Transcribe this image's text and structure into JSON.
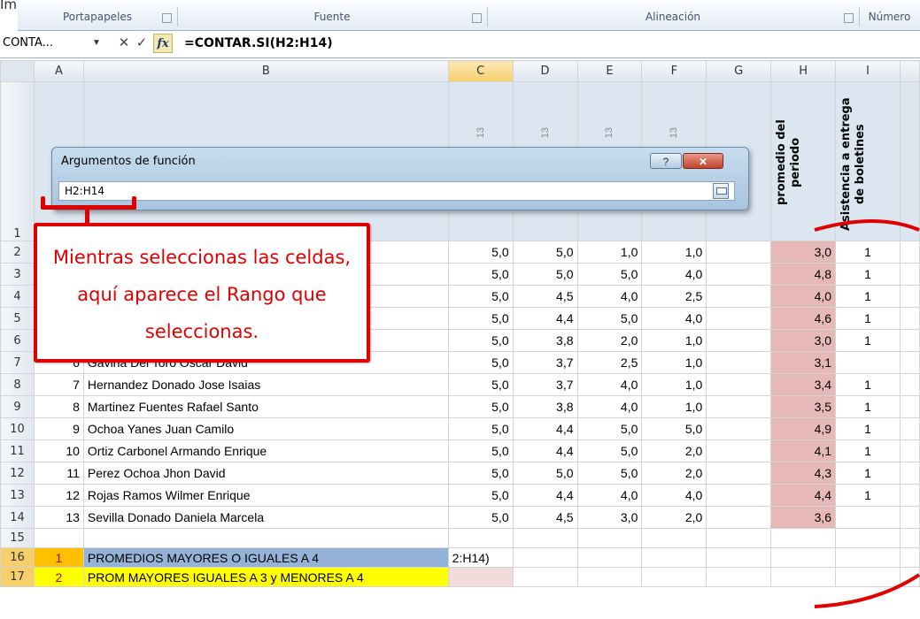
{
  "caption": "Imagen del ...",
  "ribbon": {
    "groups": [
      {
        "label": "Portapapeles"
      },
      {
        "label": "Fuente"
      },
      {
        "label": "Alineación"
      },
      {
        "label": "Número"
      }
    ]
  },
  "formula_bar": {
    "name_box": "CONTA...",
    "cancel_symbol": "✕",
    "enter_symbol": "✓",
    "fx_label": "fx",
    "formula": "=CONTAR.SI(H2:H14)"
  },
  "columns": [
    "A",
    "B",
    "C",
    "D",
    "E",
    "F",
    "G",
    "H",
    "I"
  ],
  "header_row": {
    "row_num": "1",
    "c": "13",
    "d": "13",
    "e": "13",
    "f": "13",
    "h": "promedio del periodo",
    "i": "Asistencia a entrega de boletines"
  },
  "rows": [
    {
      "row": "2",
      "a": "",
      "b": "",
      "c": "5,0",
      "d": "5,0",
      "e": "1,0",
      "f": "1,0",
      "h": "3,0",
      "i": "1"
    },
    {
      "row": "3",
      "a": "",
      "b": "",
      "c": "5,0",
      "d": "5,0",
      "e": "5,0",
      "f": "4,0",
      "h": "4,8",
      "i": "1"
    },
    {
      "row": "4",
      "a": "",
      "b": "",
      "c": "5,0",
      "d": "4,5",
      "e": "4,0",
      "f": "2,5",
      "h": "4,0",
      "i": "1"
    },
    {
      "row": "5",
      "a": "",
      "b": "",
      "c": "5,0",
      "d": "4,4",
      "e": "5,0",
      "f": "4,0",
      "h": "4,6",
      "i": "1"
    },
    {
      "row": "6",
      "a": "",
      "b": "",
      "c": "5,0",
      "d": "3,8",
      "e": "2,0",
      "f": "1,0",
      "h": "3,0",
      "i": "1"
    },
    {
      "row": "7",
      "a": "6",
      "b": "Gaviria Del Toro Oscar David",
      "c": "5,0",
      "d": "3,7",
      "e": "2,5",
      "f": "1,0",
      "h": "3,1",
      "i": ""
    },
    {
      "row": "8",
      "a": "7",
      "b": "Hernandez Donado Jose Isaias",
      "c": "5,0",
      "d": "3,7",
      "e": "4,0",
      "f": "1,0",
      "h": "3,4",
      "i": "1"
    },
    {
      "row": "9",
      "a": "8",
      "b": "Martinez Fuentes Rafael Santo",
      "c": "5,0",
      "d": "3,8",
      "e": "4,0",
      "f": "1,0",
      "h": "3,5",
      "i": "1"
    },
    {
      "row": "10",
      "a": "9",
      "b": "Ochoa Yanes Juan Camilo",
      "c": "5,0",
      "d": "4,4",
      "e": "5,0",
      "f": "5,0",
      "h": "4,9",
      "i": "1"
    },
    {
      "row": "11",
      "a": "10",
      "b": "Ortiz Carbonel Armando Enrique",
      "c": "5,0",
      "d": "4,4",
      "e": "5,0",
      "f": "2,0",
      "h": "4,1",
      "i": "1"
    },
    {
      "row": "12",
      "a": "11",
      "b": "Perez Ochoa Jhon David",
      "c": "5,0",
      "d": "5,0",
      "e": "5,0",
      "f": "2,0",
      "h": "4,3",
      "i": "1"
    },
    {
      "row": "13",
      "a": "12",
      "b": "Rojas Ramos Wilmer Enrique",
      "c": "5,0",
      "d": "4,4",
      "e": "4,0",
      "f": "4,0",
      "h": "4,4",
      "i": "1"
    },
    {
      "row": "14",
      "a": "13",
      "b": "Sevilla Donado Daniela Marcela",
      "c": "5,0",
      "d": "4,5",
      "e": "3,0",
      "f": "2,0",
      "h": "3,6",
      "i": ""
    }
  ],
  "row15": "15",
  "summary": [
    {
      "row": "16",
      "a": "1",
      "b": "PROMEDIOS MAYORES O IGUALES A 4",
      "c": "2:H14)"
    },
    {
      "row": "17",
      "a": "2",
      "b": "PROM MAYORES IGUALES A 3 y MENORES A 4",
      "c": ""
    }
  ],
  "dialog": {
    "title": "Argumentos de función",
    "help": "?",
    "close": "✕",
    "input_value": "H2:H14"
  },
  "callout": {
    "text": "Mientras seleccionas las celdas, aquí aparece el Rango que seleccionas."
  },
  "colors": {
    "accent_red": "#e00000",
    "range_fill": "#e6b8b7",
    "header_blue": "#dce6f1",
    "label_blue": "#95b3d7"
  }
}
